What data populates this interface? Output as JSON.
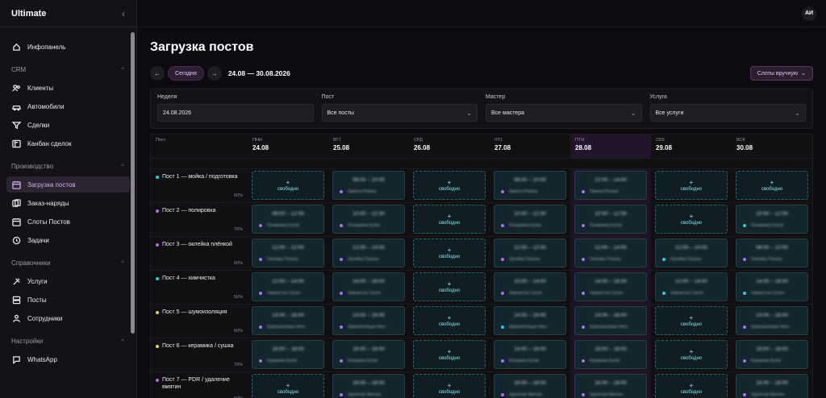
{
  "app": {
    "name": "Ultimate",
    "user_initials": "АИ"
  },
  "colors": {
    "accent": "#d8a8f0",
    "free": "#8fe0ea",
    "dot_cyan": "#34c8e0",
    "dot_violet": "#b06cf0",
    "dot_yellow": "#e8d060"
  },
  "sidebar": {
    "top": [
      {
        "label": "Инфопанель",
        "icon": "home-icon"
      }
    ],
    "sections": [
      {
        "title": "CRM",
        "items": [
          {
            "label": "Клиенты",
            "icon": "users-icon"
          },
          {
            "label": "Автомобили",
            "icon": "car-icon"
          },
          {
            "label": "Сделки",
            "icon": "filter-icon"
          },
          {
            "label": "Канбан сделок",
            "icon": "kanban-icon"
          }
        ]
      },
      {
        "title": "Производство",
        "items": [
          {
            "label": "Загрузка постов",
            "icon": "calendar-icon",
            "active": true
          },
          {
            "label": "Заказ-наряды",
            "icon": "orders-icon"
          },
          {
            "label": "Слоты Постов",
            "icon": "calendar-icon"
          },
          {
            "label": "Задачи",
            "icon": "clock-icon"
          }
        ]
      },
      {
        "title": "Справочники",
        "items": [
          {
            "label": "Услуги",
            "icon": "tools-icon"
          },
          {
            "label": "Посты",
            "icon": "layers-icon"
          },
          {
            "label": "Сотрудники",
            "icon": "team-icon"
          }
        ]
      },
      {
        "title": "Настройки",
        "items": [
          {
            "label": "WhatsApp",
            "icon": "chat-icon"
          }
        ]
      }
    ]
  },
  "page": {
    "title": "Загрузка постов",
    "prev": "←",
    "next": "→",
    "today": "Сегодня",
    "range": "24.08 — 30.08.2026",
    "manual": "Слоты вручную"
  },
  "filters": [
    {
      "label": "Неделя",
      "value": "24.08.2026",
      "type": "input"
    },
    {
      "label": "Пост",
      "value": "Все посты",
      "type": "select"
    },
    {
      "label": "Мастер",
      "value": "Все мастера",
      "type": "select"
    },
    {
      "label": "Услуга",
      "value": "Все услуги",
      "type": "select"
    }
  ],
  "grid": {
    "post_header": "Пост",
    "free_label": "свободно",
    "days": [
      {
        "day": "ПНН",
        "date": "24.08"
      },
      {
        "day": "ВТ7",
        "date": "25.08"
      },
      {
        "day": "СРД",
        "date": "26.08"
      },
      {
        "day": "ЧТ1",
        "date": "27.08"
      },
      {
        "day": "ПТН",
        "date": "28.08",
        "highlight": true
      },
      {
        "day": "СБ5",
        "date": "29.08"
      },
      {
        "day": "ВСК",
        "date": "30.08"
      }
    ],
    "posts": [
      {
        "name": "Пост 1 — мойка / подготовка",
        "load": "60%",
        "dot": "cyan",
        "slots": [
          {
            "free": true
          },
          {
            "time": "08:00 – 10:00",
            "master": "Замена Резина",
            "dot": "violet"
          },
          {
            "free": true
          },
          {
            "time": "08:00 – 10:00",
            "master": "Замена Резина",
            "dot": "violet"
          },
          {
            "time": "12:00 – 14:00",
            "master": "Замена Резина",
            "dot": "violet"
          },
          {
            "free": true
          },
          {
            "free": true
          }
        ]
      },
      {
        "name": "Пост 2 — полировка",
        "load": "70%",
        "dot": "violet",
        "slots": [
          {
            "time": "08:00 – 12:00",
            "master": "Полировка Кузов",
            "dot": "violet"
          },
          {
            "time": "10:00 – 12:00",
            "master": "Полировка Кузов",
            "dot": "violet"
          },
          {
            "free": true
          },
          {
            "time": "10:00 – 12:00",
            "master": "Полировка Кузов",
            "dot": "violet"
          },
          {
            "time": "10:00 – 12:00",
            "master": "Полировка Кузов",
            "dot": "violet"
          },
          {
            "free": true
          },
          {
            "time": "10:00 – 12:00",
            "master": "Полировка Кузов",
            "dot": "cyan"
          }
        ]
      },
      {
        "name": "Пост 3 — оклейка плёнкой",
        "load": "60%",
        "dot": "violet",
        "slots": [
          {
            "time": "12:00 – 12:00",
            "master": "Оклейка Пленка",
            "dot": "violet"
          },
          {
            "time": "12:00 – 14:00",
            "master": "Оклейка Пленка",
            "dot": "violet"
          },
          {
            "free": true
          },
          {
            "time": "12:00 – 12:00",
            "master": "Оклейка Пленка",
            "dot": "violet"
          },
          {
            "time": "12:00 – 14:00",
            "master": "Оклейка Пленка",
            "dot": "violet"
          },
          {
            "time": "12:00 – 14:00",
            "master": "Оклейка Пленка",
            "dot": "cyan"
          },
          {
            "time": "08:00 – 10:00",
            "master": "Оклейка Пленка",
            "dot": "violet"
          }
        ]
      },
      {
        "name": "Пост 4 — химчистка",
        "load": "50%",
        "dot": "cyan",
        "slots": [
          {
            "time": "12:00 – 14:00",
            "master": "Химчистка Салон",
            "dot": "violet"
          },
          {
            "time": "14:00 – 16:00",
            "master": "Химчистка Салон",
            "dot": "violet"
          },
          {
            "free": true
          },
          {
            "time": "10:00 – 14:00",
            "master": "Химчистка Салон",
            "dot": "violet"
          },
          {
            "time": "14:00 – 16:00",
            "master": "Химчистка Салон",
            "dot": "violet"
          },
          {
            "time": "12:00 – 14:00",
            "master": "Химчистка Салон",
            "dot": "cyan"
          },
          {
            "time": "14:00 – 16:00",
            "master": "Химчистка Салон",
            "dot": "cyan"
          }
        ]
      },
      {
        "name": "Пост 5 — шумоизоляция",
        "load": "60%",
        "dot": "yellow",
        "slots": [
          {
            "time": "14:00 – 16:00",
            "master": "Шумоизоляция Авто",
            "dot": "violet"
          },
          {
            "time": "14:00 – 16:00",
            "master": "Шумоизоляция Авто",
            "dot": "violet"
          },
          {
            "free": true
          },
          {
            "time": "14:00 – 16:00",
            "master": "Шумоизоляция Авто",
            "dot": "cyan"
          },
          {
            "time": "14:00 – 16:00",
            "master": "Шумоизоляция Авто",
            "dot": "violet"
          },
          {
            "free": true
          },
          {
            "time": "14:00 – 16:00",
            "master": "Шумоизоляция Авто",
            "dot": "violet"
          }
        ]
      },
      {
        "name": "Пост 6 — керамика / сушка",
        "load": "70%",
        "dot": "yellow",
        "slots": [
          {
            "time": "16:00 – 18:00",
            "master": "Керамика Кузов",
            "dot": "violet"
          },
          {
            "time": "16:00 – 18:00",
            "master": "Керамика Кузов",
            "dot": "violet"
          },
          {
            "free": true
          },
          {
            "time": "14:00 – 18:00",
            "master": "Керамика Кузов",
            "dot": "violet"
          },
          {
            "time": "16:00 – 18:00",
            "master": "Керамика Кузов",
            "dot": "violet"
          },
          {
            "free": true
          },
          {
            "time": "16:00 – 18:00",
            "master": "Керамика Кузов",
            "dot": "violet"
          }
        ]
      },
      {
        "name": "Пост 7 — PDR / удаление вмятин",
        "load": "60%",
        "dot": "violet",
        "slots": [
          {
            "free": true
          },
          {
            "time": "16:00 – 18:00",
            "master": "Удаление Вмятин",
            "dot": "violet"
          },
          {
            "free": true
          },
          {
            "time": "16:00 – 18:00",
            "master": "Удаление Вмятин",
            "dot": "violet"
          },
          {
            "time": "16:00 – 18:00",
            "master": "Удаление Вмятин",
            "dot": "violet"
          },
          {
            "free": true
          },
          {
            "time": "16:00 – 18:00",
            "master": "Удаление Вмятин",
            "dot": "violet"
          }
        ]
      }
    ]
  }
}
